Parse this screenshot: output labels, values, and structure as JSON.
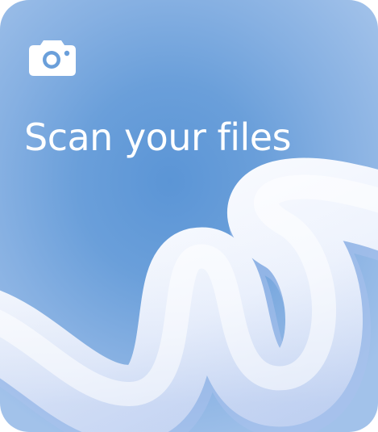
{
  "card": {
    "title": "Scan your files",
    "icon": "camera-icon"
  },
  "colors": {
    "background_center": "#5b95d6",
    "background_edge": "#a2c2ea",
    "text": "#ffffff",
    "ribbon_light": "#ffffff",
    "ribbon_shadow": "#b7ccf0"
  }
}
